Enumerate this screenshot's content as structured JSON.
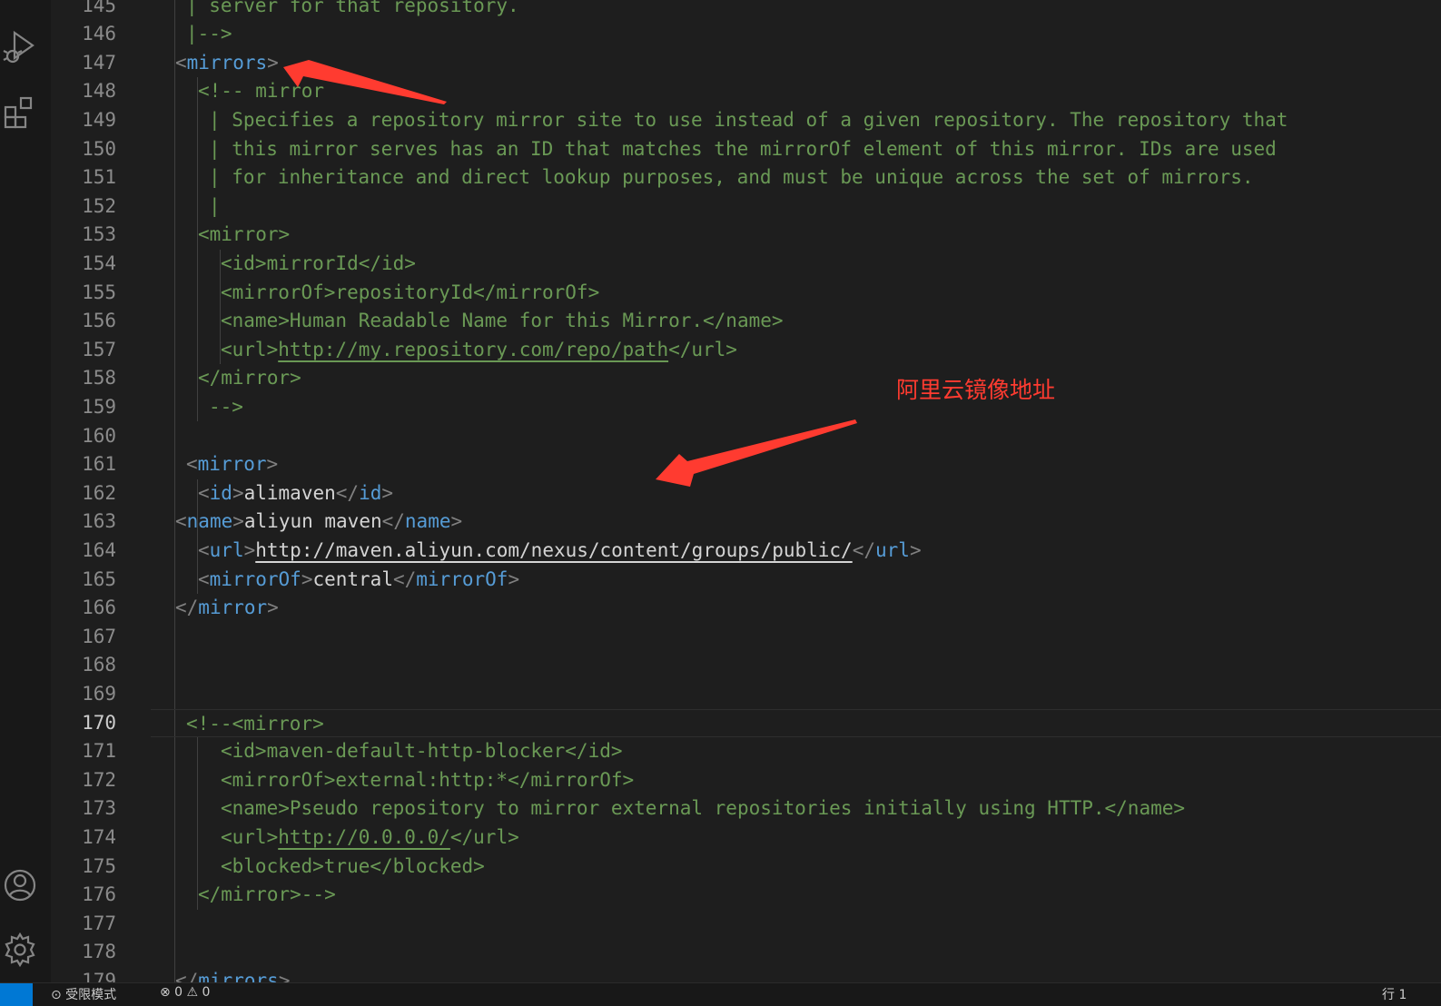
{
  "activity_bar": {
    "icons": [
      "run-debug-icon",
      "extensions-icon",
      "account-icon",
      "settings-gear-icon"
    ]
  },
  "editor": {
    "current_line": "170",
    "lines": [
      {
        "n": "145",
        "indent": 1,
        "tokens": [
          {
            "t": "| server for that repository.",
            "c": "cm"
          }
        ]
      },
      {
        "n": "146",
        "indent": 1,
        "tokens": [
          {
            "t": "|-->",
            "c": "cm"
          }
        ]
      },
      {
        "n": "147",
        "indent": 0,
        "tokens": [
          {
            "t": "<",
            "c": "pu"
          },
          {
            "t": "mirrors",
            "c": "tg"
          },
          {
            "t": ">",
            "c": "pu"
          }
        ]
      },
      {
        "n": "148",
        "indent": 2,
        "tokens": [
          {
            "t": "<!-- mirror",
            "c": "cm"
          }
        ]
      },
      {
        "n": "149",
        "indent": 3,
        "tokens": [
          {
            "t": "| Specifies a repository mirror site to use instead of a given repository. The repository that",
            "c": "cm"
          }
        ]
      },
      {
        "n": "150",
        "indent": 3,
        "tokens": [
          {
            "t": "| this mirror serves has an ID that matches the mirrorOf element of this mirror. IDs are used",
            "c": "cm"
          }
        ]
      },
      {
        "n": "151",
        "indent": 3,
        "tokens": [
          {
            "t": "| for inheritance and direct lookup purposes, and must be unique across the set of mirrors.",
            "c": "cm"
          }
        ]
      },
      {
        "n": "152",
        "indent": 3,
        "tokens": [
          {
            "t": "|",
            "c": "cm"
          }
        ]
      },
      {
        "n": "153",
        "indent": 2,
        "tokens": [
          {
            "t": "<mirror>",
            "c": "cm"
          }
        ]
      },
      {
        "n": "154",
        "indent": 4,
        "tokens": [
          {
            "t": "<id>mirrorId</id>",
            "c": "cm"
          }
        ]
      },
      {
        "n": "155",
        "indent": 4,
        "tokens": [
          {
            "t": "<mirrorOf>repositoryId</mirrorOf>",
            "c": "cm"
          }
        ]
      },
      {
        "n": "156",
        "indent": 4,
        "tokens": [
          {
            "t": "<name>Human Readable Name for this Mirror.</name>",
            "c": "cm"
          }
        ]
      },
      {
        "n": "157",
        "indent": 4,
        "tokens": [
          {
            "t": "<url>",
            "c": "cm"
          },
          {
            "t": "http://my.repository.com/repo/path",
            "c": "cm url"
          },
          {
            "t": "</url>",
            "c": "cm"
          }
        ]
      },
      {
        "n": "158",
        "indent": 2,
        "tokens": [
          {
            "t": "</mirror>",
            "c": "cm"
          }
        ]
      },
      {
        "n": "159",
        "indent": 3,
        "tokens": [
          {
            "t": "-->",
            "c": "cm"
          }
        ]
      },
      {
        "n": "160",
        "indent": 0,
        "tokens": []
      },
      {
        "n": "161",
        "indent": 1,
        "tokens": [
          {
            "t": "<",
            "c": "pu"
          },
          {
            "t": "mirror",
            "c": "tg"
          },
          {
            "t": ">",
            "c": "pu"
          }
        ]
      },
      {
        "n": "162",
        "indent": 2,
        "tokens": [
          {
            "t": "<",
            "c": "pu"
          },
          {
            "t": "id",
            "c": "tg"
          },
          {
            "t": ">",
            "c": "pu"
          },
          {
            "t": "alimaven",
            "c": "tx"
          },
          {
            "t": "</",
            "c": "pu"
          },
          {
            "t": "id",
            "c": "tg"
          },
          {
            "t": ">",
            "c": "pu"
          }
        ]
      },
      {
        "n": "163",
        "indent": 0,
        "tokens": [
          {
            "t": "<",
            "c": "pu"
          },
          {
            "t": "name",
            "c": "tg"
          },
          {
            "t": ">",
            "c": "pu"
          },
          {
            "t": "aliyun maven",
            "c": "tx"
          },
          {
            "t": "</",
            "c": "pu"
          },
          {
            "t": "name",
            "c": "tg"
          },
          {
            "t": ">",
            "c": "pu"
          }
        ]
      },
      {
        "n": "164",
        "indent": 2,
        "tokens": [
          {
            "t": "<",
            "c": "pu"
          },
          {
            "t": "url",
            "c": "tg"
          },
          {
            "t": ">",
            "c": "pu"
          },
          {
            "t": "http://maven.aliyun.com/nexus/content/groups/public/",
            "c": "tx url"
          },
          {
            "t": "</",
            "c": "pu"
          },
          {
            "t": "url",
            "c": "tg"
          },
          {
            "t": ">",
            "c": "pu"
          }
        ]
      },
      {
        "n": "165",
        "indent": 2,
        "tokens": [
          {
            "t": "<",
            "c": "pu"
          },
          {
            "t": "mirrorOf",
            "c": "tg"
          },
          {
            "t": ">",
            "c": "pu"
          },
          {
            "t": "central",
            "c": "tx"
          },
          {
            "t": "</",
            "c": "pu"
          },
          {
            "t": "mirrorOf",
            "c": "tg"
          },
          {
            "t": ">",
            "c": "pu"
          }
        ]
      },
      {
        "n": "166",
        "indent": 0,
        "tokens": [
          {
            "t": "</",
            "c": "pu"
          },
          {
            "t": "mirror",
            "c": "tg"
          },
          {
            "t": ">",
            "c": "pu"
          }
        ]
      },
      {
        "n": "167",
        "indent": 0,
        "tokens": []
      },
      {
        "n": "168",
        "indent": 0,
        "tokens": []
      },
      {
        "n": "169",
        "indent": 0,
        "tokens": []
      },
      {
        "n": "170",
        "indent": 1,
        "tokens": [
          {
            "t": "<!--<mirror>",
            "c": "cm"
          }
        ]
      },
      {
        "n": "171",
        "indent": 4,
        "tokens": [
          {
            "t": "<id>maven-default-http-blocker</id>",
            "c": "cm"
          }
        ]
      },
      {
        "n": "172",
        "indent": 4,
        "tokens": [
          {
            "t": "<mirrorOf>external:http:*</mirrorOf>",
            "c": "cm"
          }
        ]
      },
      {
        "n": "173",
        "indent": 4,
        "tokens": [
          {
            "t": "<name>Pseudo repository to mirror external repositories initially using HTTP.</name>",
            "c": "cm"
          }
        ]
      },
      {
        "n": "174",
        "indent": 4,
        "tokens": [
          {
            "t": "<url>",
            "c": "cm"
          },
          {
            "t": "http://0.0.0.0/",
            "c": "cm url"
          },
          {
            "t": "</url>",
            "c": "cm"
          }
        ]
      },
      {
        "n": "175",
        "indent": 4,
        "tokens": [
          {
            "t": "<blocked>true</blocked>",
            "c": "cm"
          }
        ]
      },
      {
        "n": "176",
        "indent": 2,
        "tokens": [
          {
            "t": "</mirror>-->",
            "c": "cm"
          }
        ]
      },
      {
        "n": "177",
        "indent": 0,
        "tokens": []
      },
      {
        "n": "178",
        "indent": 0,
        "tokens": []
      },
      {
        "n": "179",
        "indent": 0,
        "tokens": [
          {
            "t": "</",
            "c": "pu"
          },
          {
            "t": "mirrors",
            "c": "tg"
          },
          {
            "t": ">",
            "c": "pu"
          }
        ]
      }
    ]
  },
  "annotation": {
    "label": "阿里云镜像地址",
    "color": "#ff3b30"
  },
  "status_bar": {
    "left_item": "⊙ 受限模式",
    "middle_item": "⊗ 0 ⚠ 0",
    "right_item": "行 1"
  }
}
